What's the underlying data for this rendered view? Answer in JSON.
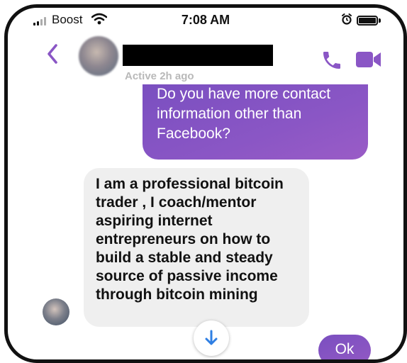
{
  "status_bar": {
    "carrier": "Boost",
    "time": "7:08 AM"
  },
  "header": {
    "contact_name": "",
    "active_status": "Active 2h ago"
  },
  "messages": [
    {
      "direction": "outgoing",
      "lines": [
        "Do you have more contact",
        "information other than",
        "Facebook?"
      ]
    },
    {
      "direction": "incoming",
      "lines": [
        "I am a professional bitcoin",
        "trader , I coach/mentor",
        "aspiring internet",
        "entrepreneurs on how to",
        "build a stable and steady",
        "source of passive income",
        "through bitcoin mining"
      ]
    }
  ],
  "quick_reply": {
    "label": "Ok"
  },
  "icons": {
    "back": "chevron-left-icon",
    "call": "phone-icon",
    "video": "video-camera-icon",
    "scroll": "arrow-down-icon",
    "wifi": "wifi-icon",
    "alarm": "alarm-clock-icon",
    "battery": "battery-icon"
  },
  "colors": {
    "accent": "#8a56c5",
    "incoming_bubble": "#efefef",
    "scroll_arrow": "#2f7fe3"
  }
}
